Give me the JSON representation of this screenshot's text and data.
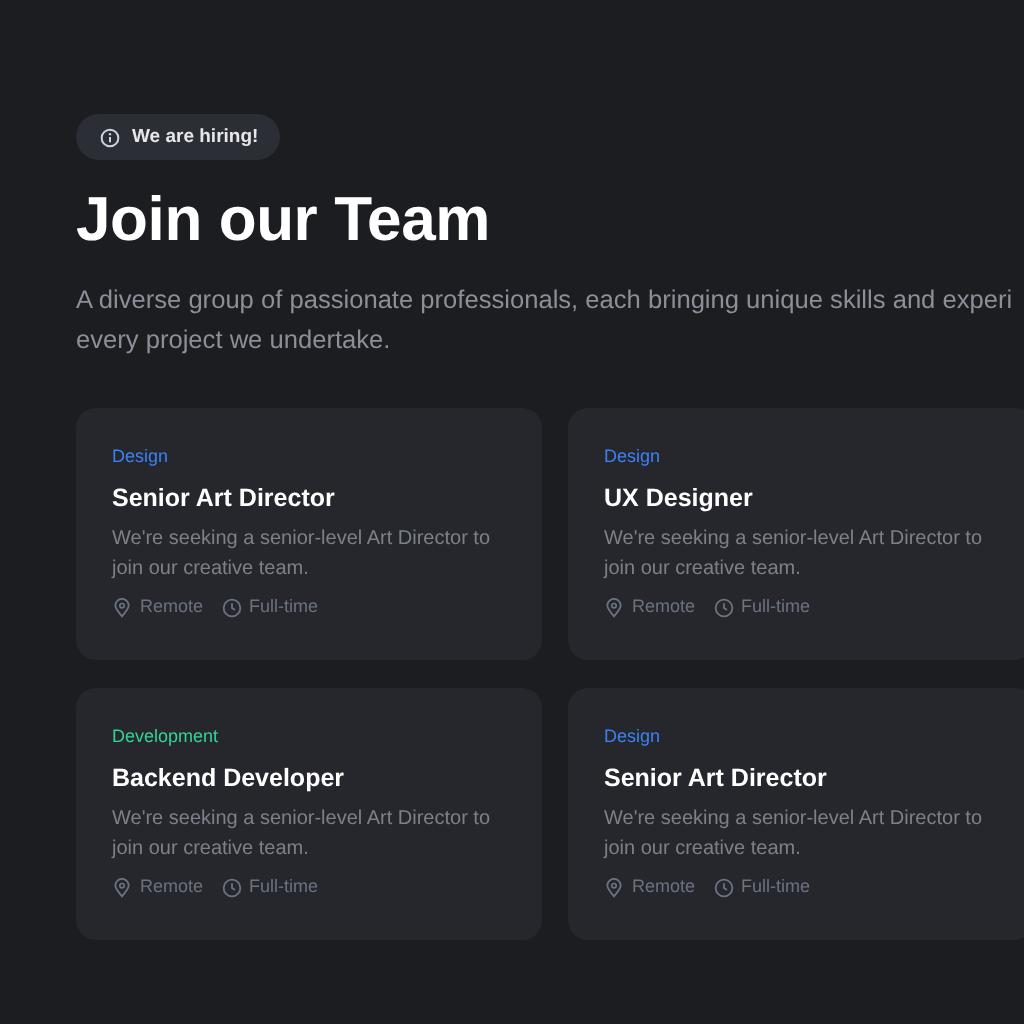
{
  "badge": {
    "label": "We are hiring!"
  },
  "title": "Join our Team",
  "subtitle_lines": [
    "A diverse group of passionate professionals, each bringing unique skills and experi",
    "every project we undertake."
  ],
  "jobs": [
    {
      "category": "Design",
      "color": "#3b82f6",
      "title": "Senior Art Director",
      "description": "We're seeking a senior-level Art Director to join our creative team.",
      "location": "Remote",
      "type": "Full-time"
    },
    {
      "category": "Design",
      "color": "#3b82f6",
      "title": "UX Designer",
      "description": "We're seeking a senior-level Art Director to join our creative team.",
      "location": "Remote",
      "type": "Full-time"
    },
    {
      "category": "Development",
      "color": "#34d399",
      "title": "Backend Developer",
      "description": "We're seeking a senior-level Art Director to join our creative team.",
      "location": "Remote",
      "type": "Full-time"
    },
    {
      "category": "Design",
      "color": "#3b82f6",
      "title": "Senior Art Director",
      "description": "We're seeking a senior-level Art Director to join our creative team.",
      "location": "Remote",
      "type": "Full-time"
    }
  ]
}
